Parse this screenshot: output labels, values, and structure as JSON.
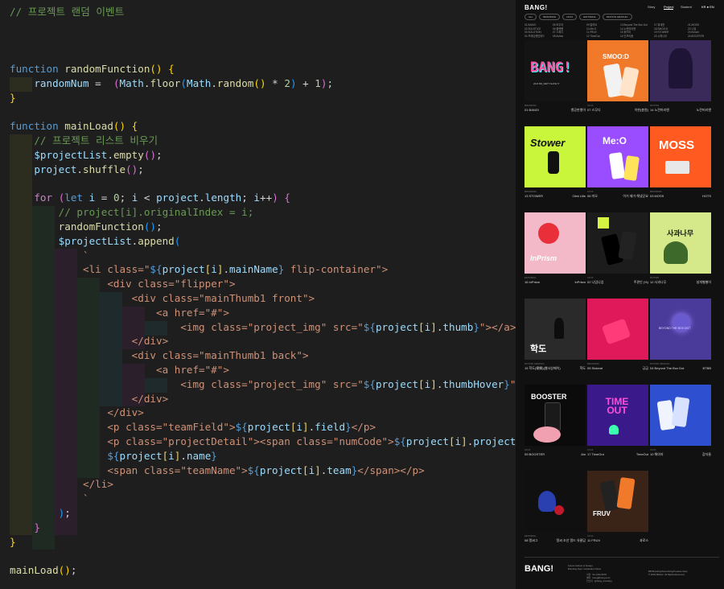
{
  "editor": {
    "lines": [
      [
        [
          "t-com",
          "// 프로젝트 랜덤 이벤트"
        ]
      ],
      [],
      [],
      [],
      [
        [
          "t-kw",
          "function "
        ],
        [
          "t-fn",
          "randomFunction"
        ],
        [
          "t-br1",
          "() {"
        ]
      ],
      [
        [
          "t-plain",
          "    "
        ],
        [
          "t-var",
          "randomNum"
        ],
        [
          "t-op",
          " =  "
        ],
        [
          "t-br2",
          "("
        ],
        [
          "t-var",
          "Math"
        ],
        [
          "t-op",
          "."
        ],
        [
          "t-fn",
          "floor"
        ],
        [
          "t-br3",
          "("
        ],
        [
          "t-var",
          "Math"
        ],
        [
          "t-op",
          "."
        ],
        [
          "t-fn",
          "random"
        ],
        [
          "t-br1",
          "()"
        ],
        [
          "t-op",
          " * "
        ],
        [
          "t-num",
          "2"
        ],
        [
          "t-br3",
          ")"
        ],
        [
          "t-op",
          " + "
        ],
        [
          "t-num",
          "1"
        ],
        [
          "t-br2",
          ")"
        ],
        [
          "t-op",
          ";"
        ]
      ],
      [
        [
          "t-br1",
          "}"
        ]
      ],
      [],
      [
        [
          "t-kw",
          "function "
        ],
        [
          "t-fn",
          "mainLoad"
        ],
        [
          "t-br1",
          "() {"
        ]
      ],
      [
        [
          "t-plain",
          "    "
        ],
        [
          "t-com",
          "// 프로젝트 리스트 비우기"
        ]
      ],
      [
        [
          "t-plain",
          "    "
        ],
        [
          "t-var",
          "$projectList"
        ],
        [
          "t-op",
          "."
        ],
        [
          "t-fn",
          "empty"
        ],
        [
          "t-br2",
          "()"
        ],
        [
          "t-op",
          ";"
        ]
      ],
      [
        [
          "t-plain",
          "    "
        ],
        [
          "t-var",
          "project"
        ],
        [
          "t-op",
          "."
        ],
        [
          "t-fn",
          "shuffle"
        ],
        [
          "t-br2",
          "()"
        ],
        [
          "t-op",
          ";"
        ]
      ],
      [],
      [
        [
          "t-plain",
          "    "
        ],
        [
          "t-ctl",
          "for "
        ],
        [
          "t-br2",
          "("
        ],
        [
          "t-kw",
          "let "
        ],
        [
          "t-var",
          "i"
        ],
        [
          "t-op",
          " = "
        ],
        [
          "t-num",
          "0"
        ],
        [
          "t-op",
          "; "
        ],
        [
          "t-var",
          "i"
        ],
        [
          "t-op",
          " < "
        ],
        [
          "t-var",
          "project"
        ],
        [
          "t-op",
          "."
        ],
        [
          "t-var",
          "length"
        ],
        [
          "t-op",
          "; "
        ],
        [
          "t-var",
          "i"
        ],
        [
          "t-op",
          "++"
        ],
        [
          "t-br2",
          ")"
        ],
        [
          "t-br2",
          " {"
        ]
      ],
      [
        [
          "t-plain",
          "        "
        ],
        [
          "t-com",
          "// project[i].originalIndex = i;"
        ]
      ],
      [
        [
          "t-plain",
          "        "
        ],
        [
          "t-fn",
          "randomFunction"
        ],
        [
          "t-br3",
          "()"
        ],
        [
          "t-op",
          ";"
        ]
      ],
      [
        [
          "t-plain",
          "        "
        ],
        [
          "t-var",
          "$projectList"
        ],
        [
          "t-op",
          "."
        ],
        [
          "t-fn",
          "append"
        ],
        [
          "t-br3",
          "("
        ]
      ],
      [
        [
          "t-plain",
          "            "
        ],
        [
          "t-str",
          "`"
        ]
      ],
      [
        [
          "t-plain",
          "            "
        ],
        [
          "t-str",
          "<li class=\""
        ],
        [
          "t-tmpl",
          "${"
        ],
        [
          "t-tv",
          "project"
        ],
        [
          "t-html",
          "["
        ],
        [
          "t-tv",
          "i"
        ],
        [
          "t-html",
          "]"
        ],
        [
          "t-op",
          "."
        ],
        [
          "t-tv",
          "mainName"
        ],
        [
          "t-tmpl",
          "}"
        ],
        [
          "t-str",
          " flip-container\">"
        ]
      ],
      [
        [
          "t-plain",
          "                "
        ],
        [
          "t-str",
          "<div class=\"flipper\">"
        ]
      ],
      [
        [
          "t-plain",
          "                    "
        ],
        [
          "t-str",
          "<div class=\"mainThumb1 front\">"
        ]
      ],
      [
        [
          "t-plain",
          "                        "
        ],
        [
          "t-str",
          "<a href=\"#\">"
        ]
      ],
      [
        [
          "t-plain",
          "                            "
        ],
        [
          "t-str",
          "<img class=\"project_img\" src=\""
        ],
        [
          "t-tmpl",
          "${"
        ],
        [
          "t-tv",
          "project"
        ],
        [
          "t-html",
          "["
        ],
        [
          "t-tv",
          "i"
        ],
        [
          "t-html",
          "]"
        ],
        [
          "t-op",
          "."
        ],
        [
          "t-tv",
          "thumb"
        ],
        [
          "t-tmpl",
          "}"
        ],
        [
          "t-str",
          "\"></a>"
        ]
      ],
      [
        [
          "t-plain",
          "                    "
        ],
        [
          "t-str",
          "</div>"
        ]
      ],
      [
        [
          "t-plain",
          "                    "
        ],
        [
          "t-str",
          "<div class=\"mainThumb1 back\">"
        ]
      ],
      [
        [
          "t-plain",
          "                        "
        ],
        [
          "t-str",
          "<a href=\"#\">"
        ]
      ],
      [
        [
          "t-plain",
          "                            "
        ],
        [
          "t-str",
          "<img class=\"project_img\" src=\""
        ],
        [
          "t-tmpl",
          "${"
        ],
        [
          "t-tv",
          "project"
        ],
        [
          "t-html",
          "["
        ],
        [
          "t-tv",
          "i"
        ],
        [
          "t-html",
          "]"
        ],
        [
          "t-op",
          "."
        ],
        [
          "t-tv",
          "thumbHover"
        ],
        [
          "t-tmpl",
          "}"
        ],
        [
          "t-str",
          "\"></a>"
        ]
      ],
      [
        [
          "t-plain",
          "                    "
        ],
        [
          "t-str",
          "</div>"
        ]
      ],
      [
        [
          "t-plain",
          "                "
        ],
        [
          "t-str",
          "</div>"
        ]
      ],
      [
        [
          "t-plain",
          "                "
        ],
        [
          "t-str",
          "<p class=\"teamField\">"
        ],
        [
          "t-tmpl",
          "${"
        ],
        [
          "t-tv",
          "project"
        ],
        [
          "t-html",
          "["
        ],
        [
          "t-tv",
          "i"
        ],
        [
          "t-html",
          "]"
        ],
        [
          "t-op",
          "."
        ],
        [
          "t-tv",
          "field"
        ],
        [
          "t-tmpl",
          "}"
        ],
        [
          "t-str",
          "</p>"
        ]
      ],
      [
        [
          "t-plain",
          "                "
        ],
        [
          "t-str",
          "<p class=\"projectDetail\"><span class=\"numCode\">"
        ],
        [
          "t-tmpl",
          "${"
        ],
        [
          "t-tv",
          "project"
        ],
        [
          "t-html",
          "["
        ],
        [
          "t-tv",
          "i"
        ],
        [
          "t-html",
          "]"
        ],
        [
          "t-op",
          "."
        ],
        [
          "t-tv",
          "projectNum"
        ],
        [
          "t-tmpl",
          "}"
        ],
        [
          "t-str",
          "</span>"
        ]
      ],
      [
        [
          "t-plain",
          "                "
        ],
        [
          "t-tmpl",
          "${"
        ],
        [
          "t-tv",
          "project"
        ],
        [
          "t-html",
          "["
        ],
        [
          "t-tv",
          "i"
        ],
        [
          "t-html",
          "]"
        ],
        [
          "t-op",
          "."
        ],
        [
          "t-tv",
          "name"
        ],
        [
          "t-tmpl",
          "}"
        ]
      ],
      [
        [
          "t-plain",
          "                "
        ],
        [
          "t-str",
          "<span class=\"teamName\">"
        ],
        [
          "t-tmpl",
          "${"
        ],
        [
          "t-tv",
          "project"
        ],
        [
          "t-html",
          "["
        ],
        [
          "t-tv",
          "i"
        ],
        [
          "t-html",
          "]"
        ],
        [
          "t-op",
          "."
        ],
        [
          "t-tv",
          "team"
        ],
        [
          "t-tmpl",
          "}"
        ],
        [
          "t-str",
          "</span></p>"
        ]
      ],
      [
        [
          "t-plain",
          "            "
        ],
        [
          "t-str",
          "</li>"
        ]
      ],
      [
        [
          "t-plain",
          "            "
        ],
        [
          "t-str",
          "`"
        ]
      ],
      [
        [
          "t-plain",
          "        "
        ],
        [
          "t-br3",
          ")"
        ],
        [
          "t-op",
          ";"
        ]
      ],
      [
        [
          "t-plain",
          "    "
        ],
        [
          "t-br2",
          "}"
        ]
      ],
      [
        [
          "t-br1",
          "}"
        ]
      ],
      [],
      [
        [
          "t-fn",
          "mainLoad"
        ],
        [
          "t-br1",
          "()"
        ],
        [
          "t-op",
          ";"
        ]
      ]
    ]
  },
  "site": {
    "logo": "BANG!",
    "nav": [
      "Story",
      "Project",
      "Student"
    ],
    "lang": "KR ● EN",
    "chips": [
      "ALL",
      "BRANDING",
      "UI/UX",
      "EDITORIAL",
      "MOTION GRAPHIC"
    ],
    "index_columns": [
      [
        "01 BANG!",
        "02 SOLSTICE",
        "03 SOLUTION",
        "04 프레임랜덤위드"
      ],
      [
        "05 모두의",
        "06 플랫폼",
        "07 스피디",
        "08 Ashes"
      ],
      [
        "09 알려요",
        "10 Me:O",
        "11 FRUV",
        "12 TimeOut"
      ],
      [
        "13 Beyond The Box Dot",
        "14 노란머리앤",
        "15 위드미",
        "16 인프리즘"
      ],
      [
        "17 위대한",
        "18 SMOO:D",
        "19 STOWER",
        "20 시퍼나무"
      ],
      [
        "21 MOSS",
        "22 니엄",
        "23 Kimchi",
        "24 BOOSTER"
      ]
    ],
    "projects": [
      {
        "field": "BRANDING",
        "num": "01",
        "name": "BANG!",
        "team": "뱅공판뱅이",
        "bg": "#141414"
      },
      {
        "field": "UI/UX",
        "num": "07",
        "name": "스무디",
        "team": "이현(총원)",
        "bg": "#f07a2a"
      },
      {
        "field": "MOTION",
        "num": "14",
        "name": "노란머리앤",
        "team": "노란머리앤",
        "bg": "#3a2a5a"
      },
      {
        "field": "BRANDING",
        "num": "13",
        "name": "STOWER",
        "team": "Olek Lilie",
        "bg": "#c9f53a"
      },
      {
        "field": "UI/UX",
        "num": "06",
        "name": "미오",
        "team": "이거 제가 해냈군요",
        "bg": "#9a4dff"
      },
      {
        "field": "BRANDING",
        "num": "03",
        "name": "MOSS",
        "team": "HOTS",
        "bg": "#ff5a1f"
      },
      {
        "field": "EDITORIAL",
        "num": "16",
        "name": "InPrism",
        "team": "InPrism",
        "bg": "#f3b9c8"
      },
      {
        "field": "UI/UX",
        "num": "02",
        "name": "니엄니엄",
        "team": "주관인 (%)",
        "bg": "#1c1c1c"
      },
      {
        "field": "MOTION",
        "num": "12",
        "name": "사과나무",
        "team": "날개별별이",
        "bg": "#d5e88a"
      },
      {
        "field": "MOTION GRAPHIC",
        "num": "15",
        "name": "학도(帰郷)(웹사상페이)",
        "team": "학도",
        "bg": "#2a2a2a"
      },
      {
        "field": "BRANDING",
        "num": "05",
        "name": "Slokeat",
        "team": "긍금",
        "bg": "#e01a5a"
      },
      {
        "field": "MOTION GRAPHIC",
        "num": "04",
        "name": "Beyond The Box Dot",
        "team": "BTBB",
        "bg": "#4a3a9a"
      },
      {
        "field": "UI/UX",
        "num": "09",
        "name": "BOOSTER",
        "team": "Ain",
        "bg": "#0b0b0b"
      },
      {
        "field": "UI/UX",
        "num": "17",
        "name": "TimeOut",
        "team": "TimeOut",
        "bg": "#3a1a8a"
      },
      {
        "field": "UI/UX",
        "num": "10",
        "name": "해야지",
        "team": "감자들",
        "bg": "#2e4fcf"
      },
      {
        "field": "EDITORIAL",
        "num": "08",
        "name": "얼씨그",
        "team": "얼씨 조선 얼드 유물담",
        "bg": "#101010"
      },
      {
        "field": "UI/UX",
        "num": "11",
        "name": "FRUV",
        "team": "과로스",
        "bg": "#3a2418"
      }
    ],
    "thumbs": {
      "bang": "BANG!",
      "bang_sub": "2023 BR_DEPT SHOW IT",
      "smood": "SMOO:D",
      "stower": "Stower",
      "meo": "Me:O",
      "moss": "MOSS",
      "inprism": "InPrism",
      "appletree": "사과나무",
      "hakdo": "학도",
      "btbd": "BEYOND THE BOX DOT",
      "booster": "BOOSTER",
      "timeout": "TIME OUT",
      "fruv": "FRUV"
    },
    "footer": {
      "logo": "BANG!",
      "left": "Korea Institute of Design\nBranding Dept. Graduation Show",
      "mid": "서울   02-1234-5678\n메일   bang@bang.ac.kr\n인스타   @bang_branding",
      "right": "BR Branding/Advertising/Creative Dept.\n© 2023 BANG!. All Rights Reserved."
    }
  }
}
